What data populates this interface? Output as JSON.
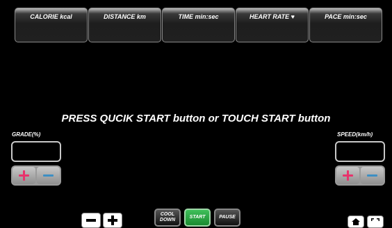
{
  "metrics": [
    {
      "label": "CALORIE kcal"
    },
    {
      "label": "DISTANCE km"
    },
    {
      "label": "TIME min:sec"
    },
    {
      "label": "HEART RATE ♥"
    },
    {
      "label": "PACE min:sec"
    }
  ],
  "prompt": "PRESS QUCIK START button or TOUCH START button",
  "grade": {
    "label": "GRADE(%)"
  },
  "speed": {
    "label": "SPEED(km/h)"
  },
  "controls": {
    "cooldown_label_line1": "COOL",
    "cooldown_label_line2": "DOWN",
    "start_label": "START",
    "pause_label": "PAUSE"
  },
  "colors": {
    "plus": "#e8336c",
    "minus": "#3d8fc4",
    "start": "#2aa845"
  },
  "icons": [
    "plus-icon",
    "minus-icon",
    "home-icon",
    "fullscreen-icon"
  ]
}
